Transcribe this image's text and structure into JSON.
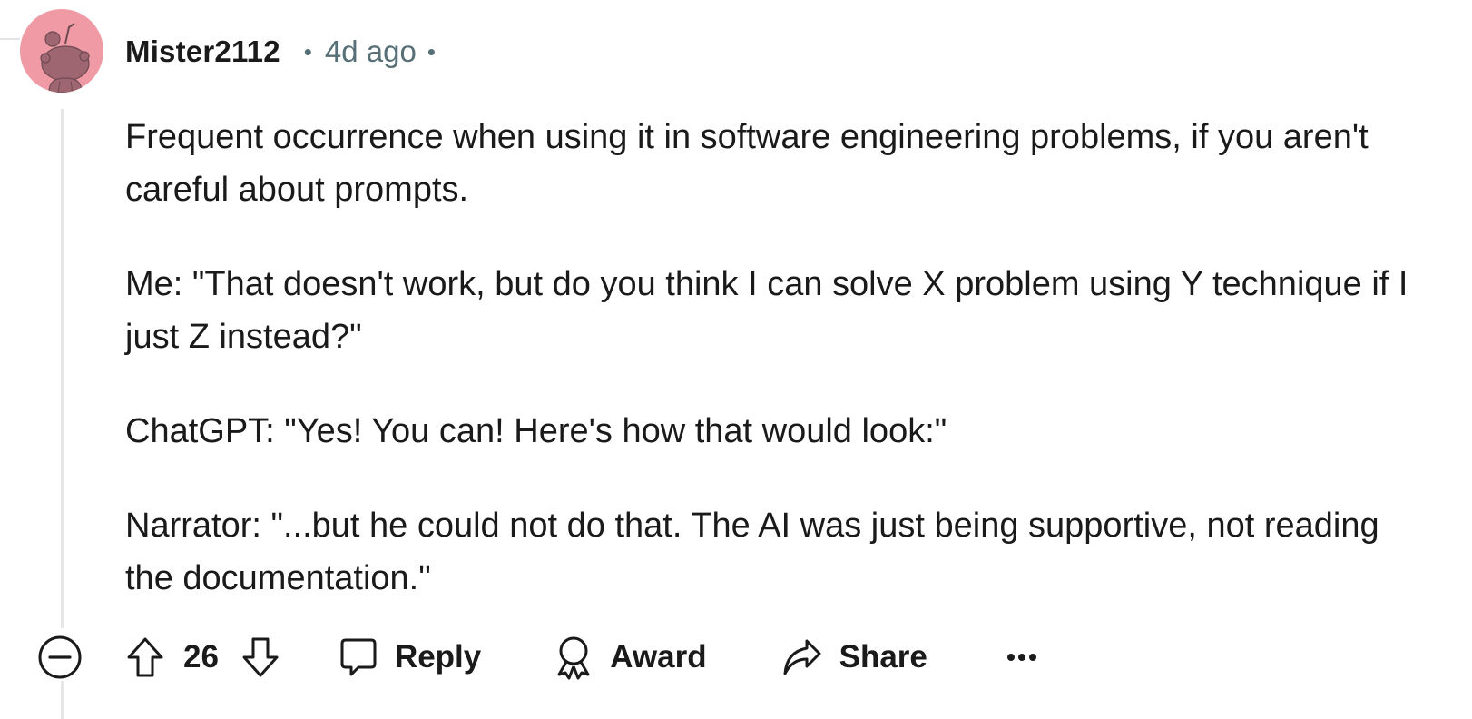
{
  "comment": {
    "author": "Mister2112",
    "separator": "•",
    "timestamp": "4d ago",
    "avatar": {
      "icon": "snoo-avatar-icon",
      "background_color": "#ef9aa4",
      "figure_color": "#9e6670"
    },
    "paragraphs": [
      "Frequent occurrence when using it in software engineering problems, if you aren't careful about prompts.",
      "Me: \"That doesn't work, but do you think I can solve X problem using Y technique if I just Z instead?\"",
      "ChatGPT: \"Yes! You can! Here's how that would look:\"",
      "Narrator: \"...but he could not do that. The AI was just being supportive, not reading the documentation.\""
    ]
  },
  "actions": {
    "collapse_icon": "collapse-minus-circle-icon",
    "upvote_icon": "upvote-arrow-icon",
    "score": "26",
    "downvote_icon": "downvote-arrow-icon",
    "reply": {
      "icon": "comment-bubble-icon",
      "label": "Reply"
    },
    "award": {
      "icon": "award-ribbon-icon",
      "label": "Award"
    },
    "share": {
      "icon": "share-arrow-icon",
      "label": "Share"
    },
    "more_icon": "more-horizontal-icon",
    "more_label": "•••"
  }
}
